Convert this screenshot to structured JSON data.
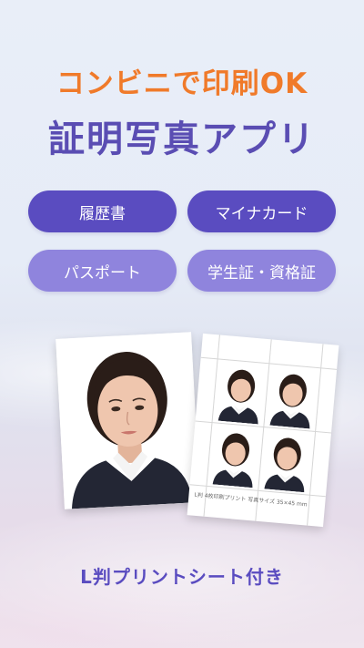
{
  "headline": {
    "line1": "コンビニで印刷OK",
    "line2": "証明写真アプリ"
  },
  "categories": [
    {
      "label": "履歴書",
      "style": "dark"
    },
    {
      "label": "マイナカード",
      "style": "dark"
    },
    {
      "label": "パスポート",
      "style": "light"
    },
    {
      "label": "学生証・資格証",
      "style": "light"
    }
  ],
  "colors": {
    "accent_orange": "#f07a2a",
    "brand_purple": "#5a4db3",
    "pill_dark": "#5a4cc0",
    "pill_light": "#8f84dd"
  },
  "sheet_caption": "L判 4枚印刷プリント 写真サイズ 35×45 mm",
  "footer": "L判プリントシート付き"
}
